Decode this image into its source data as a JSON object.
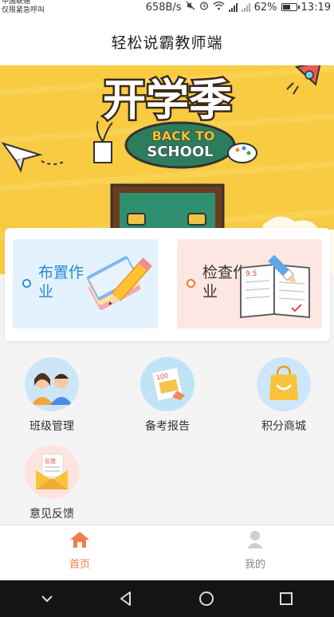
{
  "status_bar": {
    "carrier_line1": "中国联通",
    "carrier_line2": "仅限紧急呼叫",
    "net_speed": "658B/s",
    "battery_percent": "62%",
    "battery_level": 0.62,
    "time": "13:19"
  },
  "header": {
    "title": "轻松说霸教师端"
  },
  "banner": {
    "headline": "开学季",
    "subtitle_line1": "BACK TO",
    "subtitle_line2": "SCHOOL"
  },
  "cards": [
    {
      "title": "布置作业",
      "color": "#2a87d8"
    },
    {
      "title": "检查作业",
      "color": "#333333",
      "art_text": "9.5"
    }
  ],
  "menu": [
    {
      "label": "班级管理",
      "icon": "class-management-icon"
    },
    {
      "label": "备考报告",
      "icon": "exam-report-icon",
      "art_text": "100"
    },
    {
      "label": "积分商城",
      "icon": "points-mall-icon"
    },
    {
      "label": "意见反馈",
      "icon": "feedback-icon",
      "art_text": "反馈"
    }
  ],
  "tab_bar": {
    "home": {
      "label": "首页",
      "active_color": "#f57c4f"
    },
    "mine": {
      "label": "我的"
    }
  }
}
